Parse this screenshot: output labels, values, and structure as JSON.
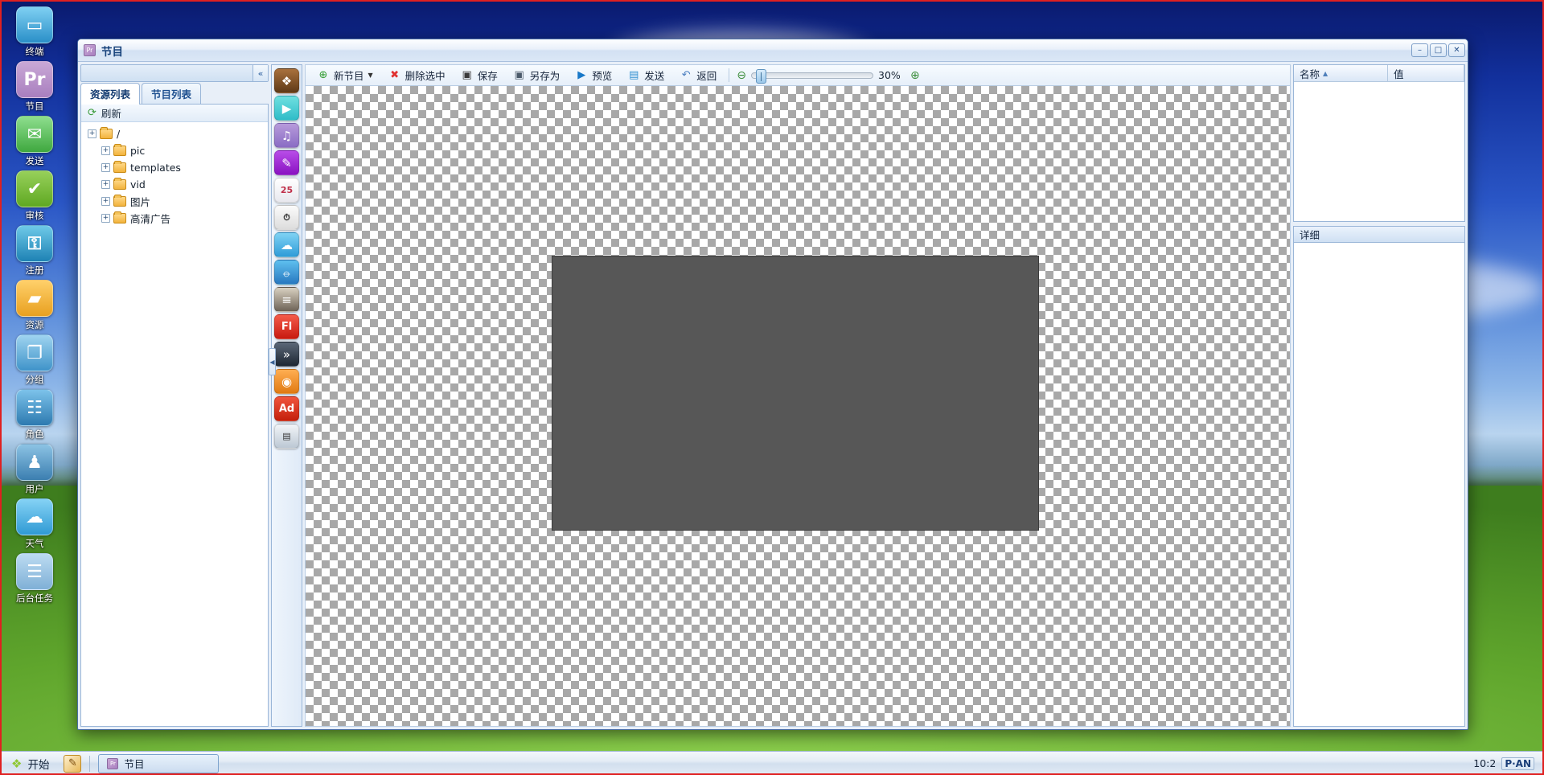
{
  "desktop": {
    "icons": [
      {
        "label": "终端",
        "icon_name": "terminal-icon",
        "glyph": "▭",
        "color1": "#7fd0f2",
        "color2": "#2a8fc8"
      },
      {
        "label": "节目",
        "icon_name": "program-icon",
        "glyph": "Pr",
        "color1": "#c9a8d6",
        "color2": "#a97fbf"
      },
      {
        "label": "发送",
        "icon_name": "send-icon",
        "glyph": "✉",
        "color1": "#8ede8e",
        "color2": "#3fa83f"
      },
      {
        "label": "审核",
        "icon_name": "approve-icon",
        "glyph": "✔",
        "color1": "#97d05a",
        "color2": "#5fa822"
      },
      {
        "label": "注册",
        "icon_name": "register-icon",
        "glyph": "⚿",
        "color1": "#6ec9e8",
        "color2": "#1e82b4"
      },
      {
        "label": "资源",
        "icon_name": "resource-icon",
        "glyph": "▰",
        "color1": "#ffd06a",
        "color2": "#e8a020"
      },
      {
        "label": "分组",
        "icon_name": "group-icon",
        "glyph": "❐",
        "color1": "#9fd4f0",
        "color2": "#3f93c9"
      },
      {
        "label": "角色",
        "icon_name": "role-icon",
        "glyph": "☷",
        "color1": "#7cc2ea",
        "color2": "#2d7ab0"
      },
      {
        "label": "用户",
        "icon_name": "user-icon",
        "glyph": "♟",
        "color1": "#8cc3e4",
        "color2": "#3b7eb0"
      },
      {
        "label": "天气",
        "icon_name": "weather-icon",
        "glyph": "☁",
        "color1": "#85d2f5",
        "color2": "#2f9ad4"
      },
      {
        "label": "后台任务",
        "icon_name": "background-task-icon",
        "glyph": "☰",
        "color1": "#bcdcf2",
        "color2": "#7fb0d6"
      }
    ]
  },
  "window": {
    "title": "节目",
    "icon_name": "program-window-icon",
    "minimize_label": "–",
    "maximize_label": "□",
    "close_label": "✕"
  },
  "left_panel": {
    "search_value": "",
    "search_placeholder": "",
    "collapse_label": "«",
    "tabs": [
      {
        "label": "资源列表",
        "active": true
      },
      {
        "label": "节目列表",
        "active": false
      }
    ],
    "refresh_label": "刷新",
    "tree": [
      {
        "label": "/",
        "depth": 0,
        "expander": "+"
      },
      {
        "label": "pic",
        "depth": 1,
        "expander": "+"
      },
      {
        "label": "templates",
        "depth": 1,
        "expander": "+"
      },
      {
        "label": "vid",
        "depth": 1,
        "expander": "+"
      },
      {
        "label": "图片",
        "depth": 1,
        "expander": "+"
      },
      {
        "label": "高清广告",
        "depth": 1,
        "expander": "+"
      }
    ]
  },
  "element_tools": [
    {
      "name": "image-element-tool",
      "glyph": "Ὓc",
      "c1": "#a9703c",
      "c2": "#5e3a18",
      "txt": "❖"
    },
    {
      "name": "video-element-tool",
      "glyph": "▶",
      "c1": "#6fe0e0",
      "c2": "#2fbcc8",
      "txt": "▶"
    },
    {
      "name": "audio-element-tool",
      "glyph": "♫",
      "c1": "#b79bdb",
      "c2": "#8a6cc4",
      "txt": "♫"
    },
    {
      "name": "text-element-tool",
      "glyph": "✎",
      "c1": "#b84ce8",
      "c2": "#8a12c2",
      "txt": "✎"
    },
    {
      "name": "calendar-element-tool",
      "glyph": "25",
      "c1": "#ffffff",
      "c2": "#e8e8ee",
      "txt": "25"
    },
    {
      "name": "clock-element-tool",
      "glyph": "11:34",
      "c1": "#fbfbfb",
      "c2": "#dcdcdc",
      "txt": "⏱"
    },
    {
      "name": "weather-element-tool",
      "glyph": "☁",
      "c1": "#7fd2f4",
      "c2": "#2f9cd8",
      "txt": "☁"
    },
    {
      "name": "web-element-tool",
      "glyph": "⦵",
      "c1": "#5fc0ef",
      "c2": "#2878c0",
      "txt": "⦵"
    },
    {
      "name": "document-element-tool",
      "glyph": "☰",
      "c1": "#d8d0c0",
      "c2": "#6e6357",
      "txt": "≡"
    },
    {
      "name": "flash-element-tool",
      "glyph": "Fl",
      "c1": "#f45b4a",
      "c2": "#c81a10",
      "txt": "Fl"
    },
    {
      "name": "animation-element-tool",
      "glyph": "»",
      "c1": "#5c6878",
      "c2": "#1d2733",
      "txt": "»"
    },
    {
      "name": "camera-element-tool",
      "glyph": "◉",
      "c1": "#ffae52",
      "c2": "#e07a12",
      "txt": "◉"
    },
    {
      "name": "ad-element-tool",
      "glyph": "Ad",
      "c1": "#f0543c",
      "c2": "#c4200c",
      "txt": "Ad"
    },
    {
      "name": "table-element-tool",
      "glyph": "▤",
      "c1": "#f2f5f8",
      "c2": "#bcc8d4",
      "txt": "▤"
    }
  ],
  "element_tools_handle": "◀",
  "toolbar": {
    "buttons": [
      {
        "label": "新节目",
        "icon_name": "new-program-icon",
        "glyph": "⊕",
        "color": "#2f9b2f",
        "has_caret": true
      },
      {
        "label": "删除选中",
        "icon_name": "delete-icon",
        "glyph": "✖",
        "color": "#e03030",
        "has_caret": false
      },
      {
        "label": "保存",
        "icon_name": "save-icon",
        "glyph": "▣",
        "color": "#3b3b3b",
        "has_caret": false
      },
      {
        "label": "另存为",
        "icon_name": "save-as-icon",
        "glyph": "▣",
        "color": "#4b5a6a",
        "has_caret": false
      },
      {
        "label": "预览",
        "icon_name": "preview-icon",
        "glyph": "▶",
        "color": "#1878c8",
        "has_caret": false
      },
      {
        "label": "发送",
        "icon_name": "send-icon",
        "glyph": "▤",
        "color": "#2f8fd0",
        "has_caret": false
      },
      {
        "label": "返回",
        "icon_name": "back-icon",
        "glyph": "↶",
        "color": "#4a7ec0",
        "has_caret": false
      }
    ],
    "zoom_out_icon": "zoom-out-icon",
    "zoom_in_icon": "zoom-in-icon",
    "zoom_out_glyph": "⊖",
    "zoom_in_glyph": "⊕",
    "zoom_value": "30%"
  },
  "canvas": {
    "stage_width": 604,
    "stage_height": 340,
    "stage_color": "#575757"
  },
  "right_panel": {
    "columns": [
      {
        "label": "名称",
        "sorted": true,
        "sort_glyph": "▲"
      },
      {
        "label": "值",
        "sorted": false,
        "sort_glyph": ""
      }
    ],
    "rows": [],
    "detail_title": "详细"
  },
  "taskbar": {
    "start_label": "开始",
    "start_icon": "start-leaf-icon",
    "quicklaunch": [
      {
        "name": "editor-quicklaunch-icon",
        "glyph": "✎",
        "color": "#e8a020"
      }
    ],
    "windows": [
      {
        "label": "节目",
        "icon_name": "program-taskbar-icon",
        "active": true
      }
    ],
    "tray": {
      "ime_label": "P·AN",
      "clock": "10:2"
    }
  }
}
